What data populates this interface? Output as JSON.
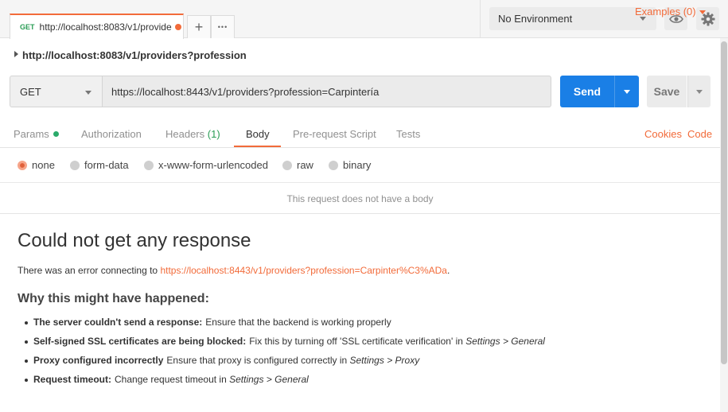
{
  "tab": {
    "method": "GET",
    "url": "http://localhost:8083/v1/provide",
    "new_tab_label": "+",
    "more_label": "•••"
  },
  "environment": {
    "selected": "No Environment"
  },
  "request": {
    "title": "http://localhost:8083/v1/providers?profession",
    "examples_label": "Examples (0)",
    "method": "GET",
    "url": "https://localhost:8443/v1/providers?profession=Carpintería",
    "send_label": "Send",
    "save_label": "Save"
  },
  "request_tabs": {
    "items": [
      "Params",
      "Authorization",
      "Headers",
      "Body",
      "Pre-request Script",
      "Tests"
    ],
    "headers_count": "(1)",
    "active": "Body",
    "cookies_label": "Cookies",
    "code_label": "Code"
  },
  "body": {
    "options": [
      "none",
      "form-data",
      "x-www-form-urlencoded",
      "raw",
      "binary"
    ],
    "selected": "none",
    "empty_message": "This request does not have a body"
  },
  "response": {
    "title": "Could not get any response",
    "error_prefix": "There was an error connecting to ",
    "error_url": "https://localhost:8443/v1/providers?profession=Carpinter%C3%ADa",
    "error_suffix": ".",
    "why_title": "Why this might have happened:",
    "reasons": [
      {
        "label": "The server couldn't send a response:",
        "text": "Ensure that the backend is working properly",
        "em": ""
      },
      {
        "label": "Self-signed SSL certificates are being blocked:",
        "text": "Fix this by turning off 'SSL certificate verification' in ",
        "em": "Settings > General"
      },
      {
        "label": "Proxy configured incorrectly",
        "text": "Ensure that proxy is configured correctly in ",
        "em": "Settings > Proxy"
      },
      {
        "label": "Request timeout:",
        "text": "Change request timeout in ",
        "em": "Settings > General"
      }
    ]
  },
  "colors": {
    "accent": "#f26b3a",
    "send_blue": "#1a7fe6",
    "method_green": "#2a9d55"
  }
}
